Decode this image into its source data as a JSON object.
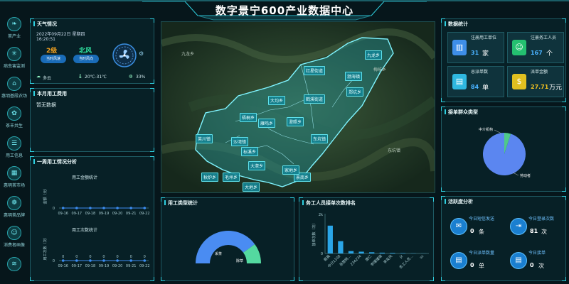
{
  "header": {
    "title": "数字景宁600产业数据中心"
  },
  "sidebar": {
    "items": [
      {
        "label": "茶产业",
        "icon": "leaf-icon",
        "glyph": "❧"
      },
      {
        "label": "病虫害监测",
        "icon": "bug-icon",
        "glyph": "✳"
      },
      {
        "label": "惠明基段农场",
        "icon": "farm-icon",
        "glyph": "⌂"
      },
      {
        "label": "茶丰共生",
        "icon": "sprout-icon",
        "glyph": "✿"
      },
      {
        "label": "用工信息",
        "icon": "worker-icon",
        "glyph": "☰"
      },
      {
        "label": "惠明茶市场",
        "icon": "market-icon",
        "glyph": "▦"
      },
      {
        "label": "惠明茶品牌",
        "icon": "brand-icon",
        "glyph": "❁"
      },
      {
        "label": "消费者画像",
        "icon": "consumer-icon",
        "glyph": "☺"
      },
      {
        "label": "",
        "icon": "layers-icon",
        "glyph": "≋"
      }
    ]
  },
  "weather": {
    "title": "天气情况",
    "date": "2022年09月22日 星期四",
    "time": "16:20:51",
    "wind_level": "2级",
    "wind_level_label": "当时风速",
    "wind_dir": "北风",
    "wind_dir_label": "当时风向",
    "condition": "多云",
    "temperature": "20℃-31℃",
    "humidity": "33%"
  },
  "labor_cost": {
    "title": "本月用工费用",
    "empty_text": "暂无数据"
  },
  "weekly": {
    "title": "一周用工情况分析",
    "chart1_title": "用工金额统计",
    "chart2_title": "用工次数统计",
    "chart1_ylabel": "金额（元）",
    "chart2_ylabel": "用工次数（次）",
    "dates": [
      "09-16",
      "09-17",
      "09-18",
      "09-19",
      "09-20",
      "09-21",
      "09-22"
    ],
    "zero": "0"
  },
  "chart_data": [
    {
      "type": "line",
      "title": "用工金额统计",
      "xlabel": "",
      "ylabel": "金额（元）",
      "categories": [
        "09-16",
        "09-17",
        "09-18",
        "09-19",
        "09-20",
        "09-21",
        "09-22"
      ],
      "values": [
        0,
        0,
        0,
        0,
        0,
        0,
        0
      ],
      "ylim": [
        0,
        1
      ]
    },
    {
      "type": "line",
      "title": "用工次数统计",
      "xlabel": "",
      "ylabel": "用工次数（次）",
      "categories": [
        "09-16",
        "09-17",
        "09-18",
        "09-19",
        "09-20",
        "09-21",
        "09-22"
      ],
      "values": [
        0,
        0,
        0,
        0,
        0,
        0,
        0
      ],
      "ylim": [
        0,
        1
      ]
    },
    {
      "type": "pie",
      "title": "用工类型统计",
      "categories": [
        "采茶",
        "除草"
      ],
      "values": [
        80,
        20
      ],
      "colors": [
        "#4a8cf2",
        "#54d9a0"
      ]
    },
    {
      "type": "bar",
      "title": "务工人员接单次数排名",
      "ylabel": "接单次数（次）",
      "yticks": [
        "2k",
        "0"
      ],
      "categories": [
        "蔡晨",
        "中分1108",
        "张慧娴…",
        "234234",
        "唐仁",
        "李瑾瑾瑞",
        "李奕凤",
        "jz",
        "务工人员…",
        "ss"
      ],
      "values": [
        1400,
        620,
        120,
        90,
        60,
        40,
        30,
        20,
        10,
        5
      ],
      "ylim": [
        0,
        2000
      ]
    },
    {
      "type": "pie",
      "title": "接单群众类型",
      "categories": [
        "中介机构",
        "劳动者"
      ],
      "values": [
        5,
        95
      ],
      "colors": [
        "#4fc98a",
        "#5b86f0"
      ]
    }
  ],
  "stats": {
    "title": "数据统计",
    "items": [
      {
        "label": "注册用工单位",
        "value": "31",
        "unit": "家",
        "color": "#3e8ee8"
      },
      {
        "label": "注册务工人员",
        "value": "167",
        "unit": "个",
        "color": "#24c070"
      },
      {
        "label": "总派单数",
        "value": "84",
        "unit": "单",
        "color": "#2fb8e0"
      },
      {
        "label": "派单金额",
        "value": "27.71",
        "unit": "万元",
        "color": "#e0c020"
      }
    ]
  },
  "worker_type": {
    "title": "接单群众类型",
    "labels": [
      "中介机构",
      "劳动者"
    ]
  },
  "job_type": {
    "title": "用工类型统计",
    "labels": [
      "采茶",
      "除草"
    ]
  },
  "ranking": {
    "title": "务工人员接单次数排名"
  },
  "activity": {
    "title": "活跃度分析",
    "items": [
      {
        "label": "今日短信发送",
        "value": "0",
        "unit": "条"
      },
      {
        "label": "今日登录次数",
        "value": "81",
        "unit": "次"
      },
      {
        "label": "今日派单数量",
        "value": "0",
        "unit": "单"
      },
      {
        "label": "今日接单",
        "value": "0",
        "unit": "次"
      }
    ]
  },
  "map": {
    "towns": [
      "九龙乡",
      "红星街道",
      "渤海镇",
      "大均乡",
      "鹤溪街道",
      "郑坑乡",
      "梧桐乡",
      "雁鸣乡",
      "澄照乡",
      "英川镇",
      "沙湾镇",
      "标溪乡",
      "大漈乡",
      "东坑镇",
      "秋炉乡",
      "毛垟乡",
      "大地乡",
      "景南乡",
      "家地乡"
    ],
    "bg_labels": [
      "东坑镇",
      "梅岐乡",
      "九龙乡"
    ]
  }
}
